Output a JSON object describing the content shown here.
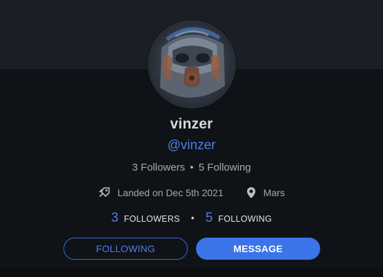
{
  "profile": {
    "display_name": "vinzer",
    "handle": "@vinzer",
    "followers_count_text": "3 Followers",
    "following_count_text": "5 Following",
    "meta_separator": "•",
    "landed_text": "Landed on Dec 5th 2021",
    "location_text": "Mars"
  },
  "stats": {
    "followers_number": "3",
    "followers_label": "FOLLOWERS",
    "following_number": "5",
    "following_label": "FOLLOWING",
    "separator": "•"
  },
  "actions": {
    "following_label": "FOLLOWING",
    "message_label": "MESSAGE"
  },
  "icons": {
    "landed": "rocket-landing-icon",
    "location": "map-pin-icon"
  },
  "colors": {
    "accent": "#4f7fe6",
    "accent_fill": "#3b74e8",
    "background": "#0f1216",
    "banner": "#1b1e24"
  }
}
